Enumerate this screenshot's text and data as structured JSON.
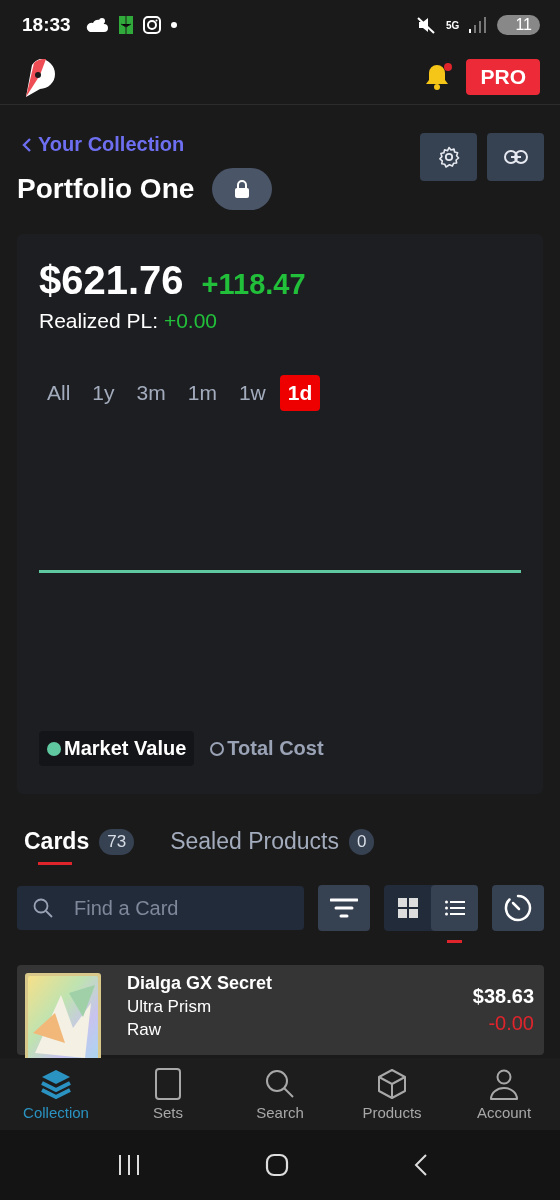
{
  "status_bar": {
    "time": "18:33",
    "network": "5G",
    "battery": "11"
  },
  "header": {
    "pro_label": "PRO",
    "notification": true
  },
  "back_link": "Your Collection",
  "portfolio": {
    "title": "Portfolio One",
    "locked": true
  },
  "summary": {
    "value": "$621.76",
    "change": "+118.47",
    "realized_label": "Realized PL:",
    "realized_value": "+0.00"
  },
  "ranges": [
    {
      "label": "All",
      "selected": false
    },
    {
      "label": "1y",
      "selected": false
    },
    {
      "label": "3m",
      "selected": false
    },
    {
      "label": "1m",
      "selected": false
    },
    {
      "label": "1w",
      "selected": false
    },
    {
      "label": "1d",
      "selected": true
    }
  ],
  "legend": [
    {
      "label": "Market Value",
      "on": true,
      "color": "#5fc8a0"
    },
    {
      "label": "Total Cost",
      "on": false,
      "color": "#9aa3b5"
    }
  ],
  "tabs": [
    {
      "label": "Cards",
      "count": "73",
      "selected": true
    },
    {
      "label": "Sealed Products",
      "count": "0",
      "selected": false
    }
  ],
  "search": {
    "placeholder": "Find a Card"
  },
  "view_modes": [
    {
      "kind": "grid",
      "selected": false
    },
    {
      "kind": "list",
      "selected": true
    }
  ],
  "cards": [
    {
      "name": "Dialga GX Secret",
      "set": "Ultra Prism",
      "condition": "Raw",
      "price": "$38.63",
      "change": "-0.00"
    }
  ],
  "nav": [
    {
      "kind": "layers",
      "label": "Collection",
      "selected": true
    },
    {
      "kind": "card",
      "label": "Sets",
      "selected": false
    },
    {
      "kind": "search",
      "label": "Search",
      "selected": false
    },
    {
      "kind": "box",
      "label": "Products",
      "selected": false
    },
    {
      "kind": "person",
      "label": "Account",
      "selected": false
    }
  ]
}
